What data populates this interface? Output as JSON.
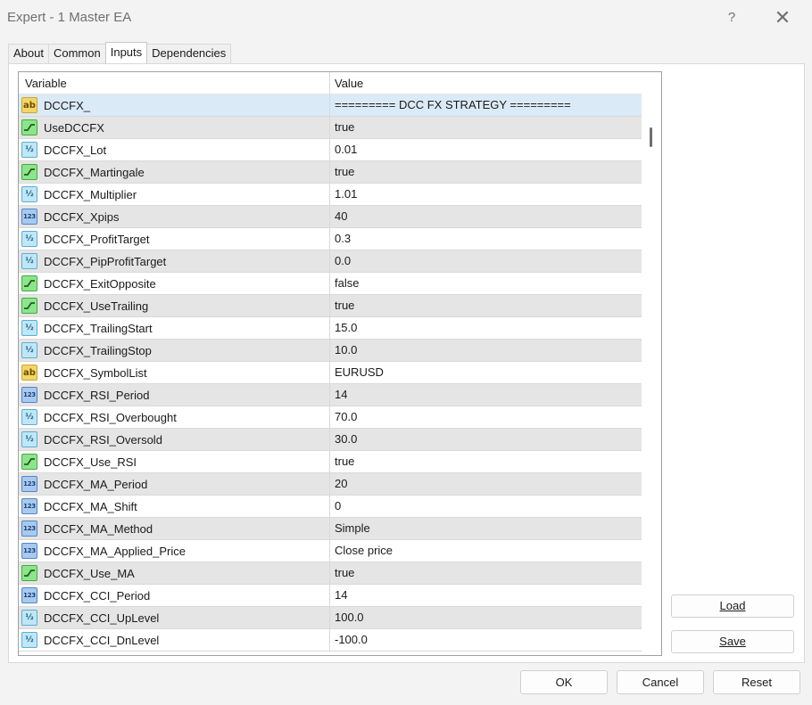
{
  "window": {
    "title": "Expert - 1 Master EA",
    "help_glyph": "?",
    "close_glyph": "✕"
  },
  "tabs": [
    {
      "label": "About",
      "active": false
    },
    {
      "label": "Common",
      "active": false
    },
    {
      "label": "Inputs",
      "active": true
    },
    {
      "label": "Dependencies",
      "active": false
    }
  ],
  "grid": {
    "columns": [
      "Variable",
      "Value"
    ],
    "rows": [
      {
        "type": "string",
        "name": "DCCFX_",
        "value": "========= DCC FX STRATEGY ========="
      },
      {
        "type": "bool",
        "name": "UseDCCFX",
        "value": "true"
      },
      {
        "type": "double",
        "name": "DCCFX_Lot",
        "value": "0.01"
      },
      {
        "type": "bool",
        "name": "DCCFX_Martingale",
        "value": "true"
      },
      {
        "type": "double",
        "name": "DCCFX_Multiplier",
        "value": "1.01"
      },
      {
        "type": "int",
        "name": "DCCFX_Xpips",
        "value": "40"
      },
      {
        "type": "double",
        "name": "DCCFX_ProfitTarget",
        "value": "0.3"
      },
      {
        "type": "double",
        "name": "DCCFX_PipProfitTarget",
        "value": "0.0"
      },
      {
        "type": "bool",
        "name": "DCCFX_ExitOpposite",
        "value": "false"
      },
      {
        "type": "bool",
        "name": "DCCFX_UseTrailing",
        "value": "true"
      },
      {
        "type": "double",
        "name": "DCCFX_TrailingStart",
        "value": "15.0"
      },
      {
        "type": "double",
        "name": "DCCFX_TrailingStop",
        "value": "10.0"
      },
      {
        "type": "string",
        "name": "DCCFX_SymbolList",
        "value": "EURUSD"
      },
      {
        "type": "int",
        "name": "DCCFX_RSI_Period",
        "value": "14"
      },
      {
        "type": "double",
        "name": "DCCFX_RSI_Overbought",
        "value": "70.0"
      },
      {
        "type": "double",
        "name": "DCCFX_RSI_Oversold",
        "value": "30.0"
      },
      {
        "type": "bool",
        "name": "DCCFX_Use_RSI",
        "value": "true"
      },
      {
        "type": "int",
        "name": "DCCFX_MA_Period",
        "value": "20"
      },
      {
        "type": "int",
        "name": "DCCFX_MA_Shift",
        "value": "0"
      },
      {
        "type": "int",
        "name": "DCCFX_MA_Method",
        "value": "Simple"
      },
      {
        "type": "int",
        "name": "DCCFX_MA_Applied_Price",
        "value": "Close price"
      },
      {
        "type": "bool",
        "name": "DCCFX_Use_MA",
        "value": "true"
      },
      {
        "type": "int",
        "name": "DCCFX_CCI_Period",
        "value": "14"
      },
      {
        "type": "double",
        "name": "DCCFX_CCI_UpLevel",
        "value": "100.0"
      },
      {
        "type": "double",
        "name": "DCCFX_CCI_DnLevel",
        "value": "-100.0"
      }
    ],
    "selected_index": 0
  },
  "icon_glyphs": {
    "string": "ab",
    "double": "½",
    "int": "123"
  },
  "buttons": {
    "load": "Load",
    "save": "Save",
    "ok": "OK",
    "cancel": "Cancel",
    "reset": "Reset"
  }
}
